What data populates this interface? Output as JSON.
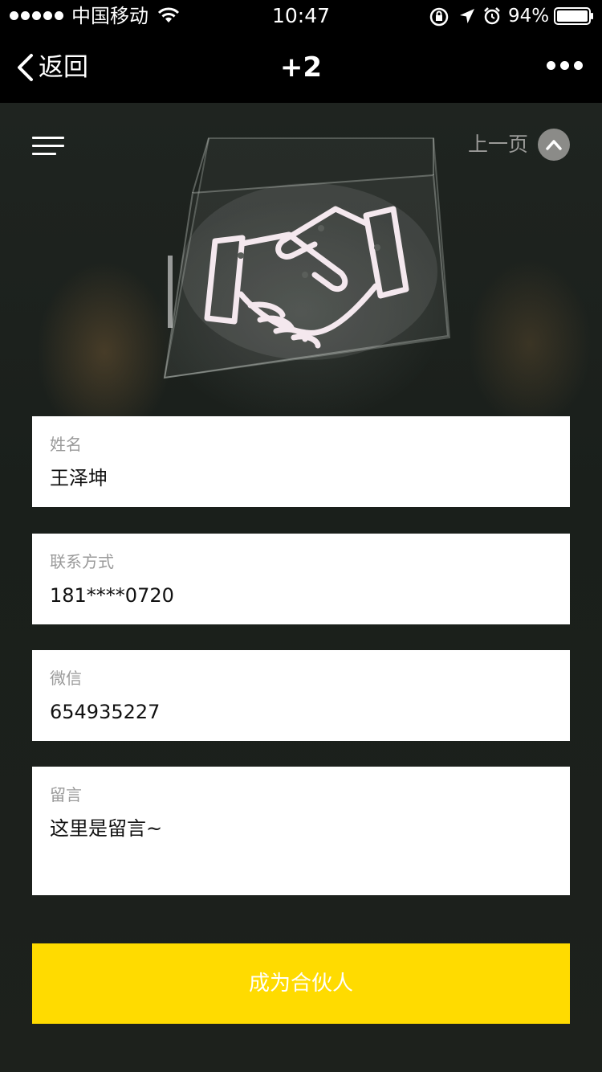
{
  "status_bar": {
    "carrier": "中国移动",
    "time": "10:47",
    "battery_percent": "94%",
    "icons": [
      "signal-dots-icon",
      "wifi-icon",
      "rotation-lock-icon",
      "location-icon",
      "alarm-icon",
      "battery-icon"
    ]
  },
  "nav": {
    "back_label": "返回",
    "title": "+2",
    "icons": [
      "chevron-left-icon",
      "more-dots-icon"
    ]
  },
  "hero": {
    "prev_page_label": "上一页",
    "icons": [
      "menu-icon",
      "chevron-up-icon",
      "neon-handshake-image"
    ]
  },
  "form": {
    "name": {
      "label": "姓名",
      "value": "王泽坤"
    },
    "contact": {
      "label": "联系方式",
      "value": "181****0720"
    },
    "wechat": {
      "label": "微信",
      "value": "654935227"
    },
    "message": {
      "label": "留言",
      "value": "这里是留言~"
    },
    "submit_label": "成为合伙人"
  },
  "colors": {
    "accent": "#ffdb00",
    "bar_background": "#000000",
    "page_background": "#1d201c",
    "label_gray": "#9a9a9a"
  }
}
